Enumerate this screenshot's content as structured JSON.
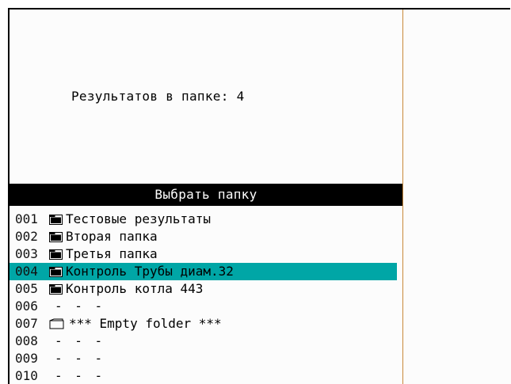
{
  "status": {
    "results_in_folder": "Результатов в папке: 4"
  },
  "folder_dialog": {
    "title": "Выбрать папку",
    "rows": [
      {
        "num": "001",
        "name": "Тестовые результаты",
        "icon": "folder-filled-icon",
        "selected": false
      },
      {
        "num": "002",
        "name": "Вторая папка",
        "icon": "folder-filled-icon",
        "selected": false
      },
      {
        "num": "003",
        "name": "Третья папка",
        "icon": "folder-filled-icon",
        "selected": false
      },
      {
        "num": "004",
        "name": "Контроль Трубы диам.32",
        "icon": "folder-filled-icon",
        "selected": true
      },
      {
        "num": "005",
        "name": "Контроль котла 443",
        "icon": "folder-filled-icon",
        "selected": false
      },
      {
        "num": "006",
        "name": "- - -",
        "icon": "",
        "selected": false
      },
      {
        "num": "007",
        "name": "*** Empty folder ***",
        "icon": "folder-outline-icon",
        "selected": false
      },
      {
        "num": "008",
        "name": "- - -",
        "icon": "",
        "selected": false
      },
      {
        "num": "009",
        "name": "- - -",
        "icon": "",
        "selected": false
      },
      {
        "num": "010",
        "name": "- - -",
        "icon": "",
        "selected": false
      }
    ]
  },
  "colors": {
    "selection": "#00a6a6",
    "divider": "#c8893a",
    "header_bg": "#000000",
    "header_fg": "#ffffff"
  }
}
